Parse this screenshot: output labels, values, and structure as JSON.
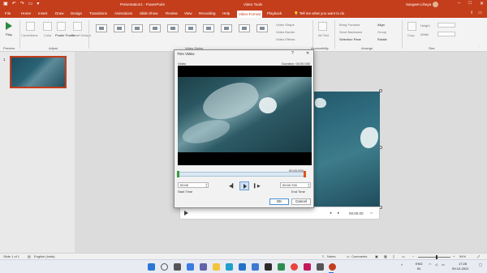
{
  "titlebar": {
    "qat": [
      "save-icon",
      "undo-icon",
      "redo-icon",
      "presenter-icon",
      "customize-icon"
    ],
    "doc_title": "Presentation1 - PowerPoint",
    "context_title": "Video Tools",
    "user": "Sangeet Lihaya",
    "window_buttons": [
      "–",
      "□",
      "✕"
    ]
  },
  "tabs": [
    {
      "label": "File"
    },
    {
      "label": "Home"
    },
    {
      "label": "Insert"
    },
    {
      "label": "Draw"
    },
    {
      "label": "Design"
    },
    {
      "label": "Transitions"
    },
    {
      "label": "Animations"
    },
    {
      "label": "Slide Show"
    },
    {
      "label": "Review"
    },
    {
      "label": "View"
    },
    {
      "label": "Recording"
    },
    {
      "label": "Help"
    },
    {
      "label": "Video Format"
    },
    {
      "label": "Playback"
    }
  ],
  "tell_me": "Tell me what you want to do",
  "ribbon": {
    "play_label": "Play",
    "preview_group": "Preview",
    "adjust_items": [
      "Corrections",
      "Color",
      "Poster Frame",
      "Reset Design"
    ],
    "adjust_group": "Adjust",
    "video_styles_group": "Video Styles",
    "shape_items": [
      "Video Shape",
      "Video Border",
      "Video Effects"
    ],
    "accessibility_item": "Alt Text",
    "accessibility_group": "Accessibility",
    "arrange_items": [
      "Bring Forward",
      "Send Backward",
      "Selection Pane"
    ],
    "arrange_items_2": [
      "Align",
      "Group",
      "Rotate"
    ],
    "arrange_group": "Arrange",
    "crop_label": "Crop",
    "size_labels": [
      "Height",
      "Width"
    ],
    "size_group": "Size"
  },
  "thumbnail": {
    "number": "1"
  },
  "dialog": {
    "title": "Trim Video",
    "help": "?",
    "close": "✕",
    "video_label": "Video",
    "duration": "Duration: 00:00.000",
    "end_seconds": "00:00.000",
    "start_time_value": "00:00",
    "start_time_label": "Start Time",
    "end_time_value": "00:00.700",
    "end_time_label": "End Time",
    "ok": "OK",
    "cancel": "Cancel"
  },
  "mediabar": {
    "time": "00:00.00"
  },
  "statusbar": {
    "slide_info": "Slide 1 of 1",
    "language": "English (India)",
    "notes": "Notes",
    "comments": "Comments",
    "zoom": "54%"
  },
  "taskbar": {
    "lang_top": "ENG",
    "lang_bottom": "IN",
    "time": "17:28",
    "date": "09-10-2021"
  }
}
